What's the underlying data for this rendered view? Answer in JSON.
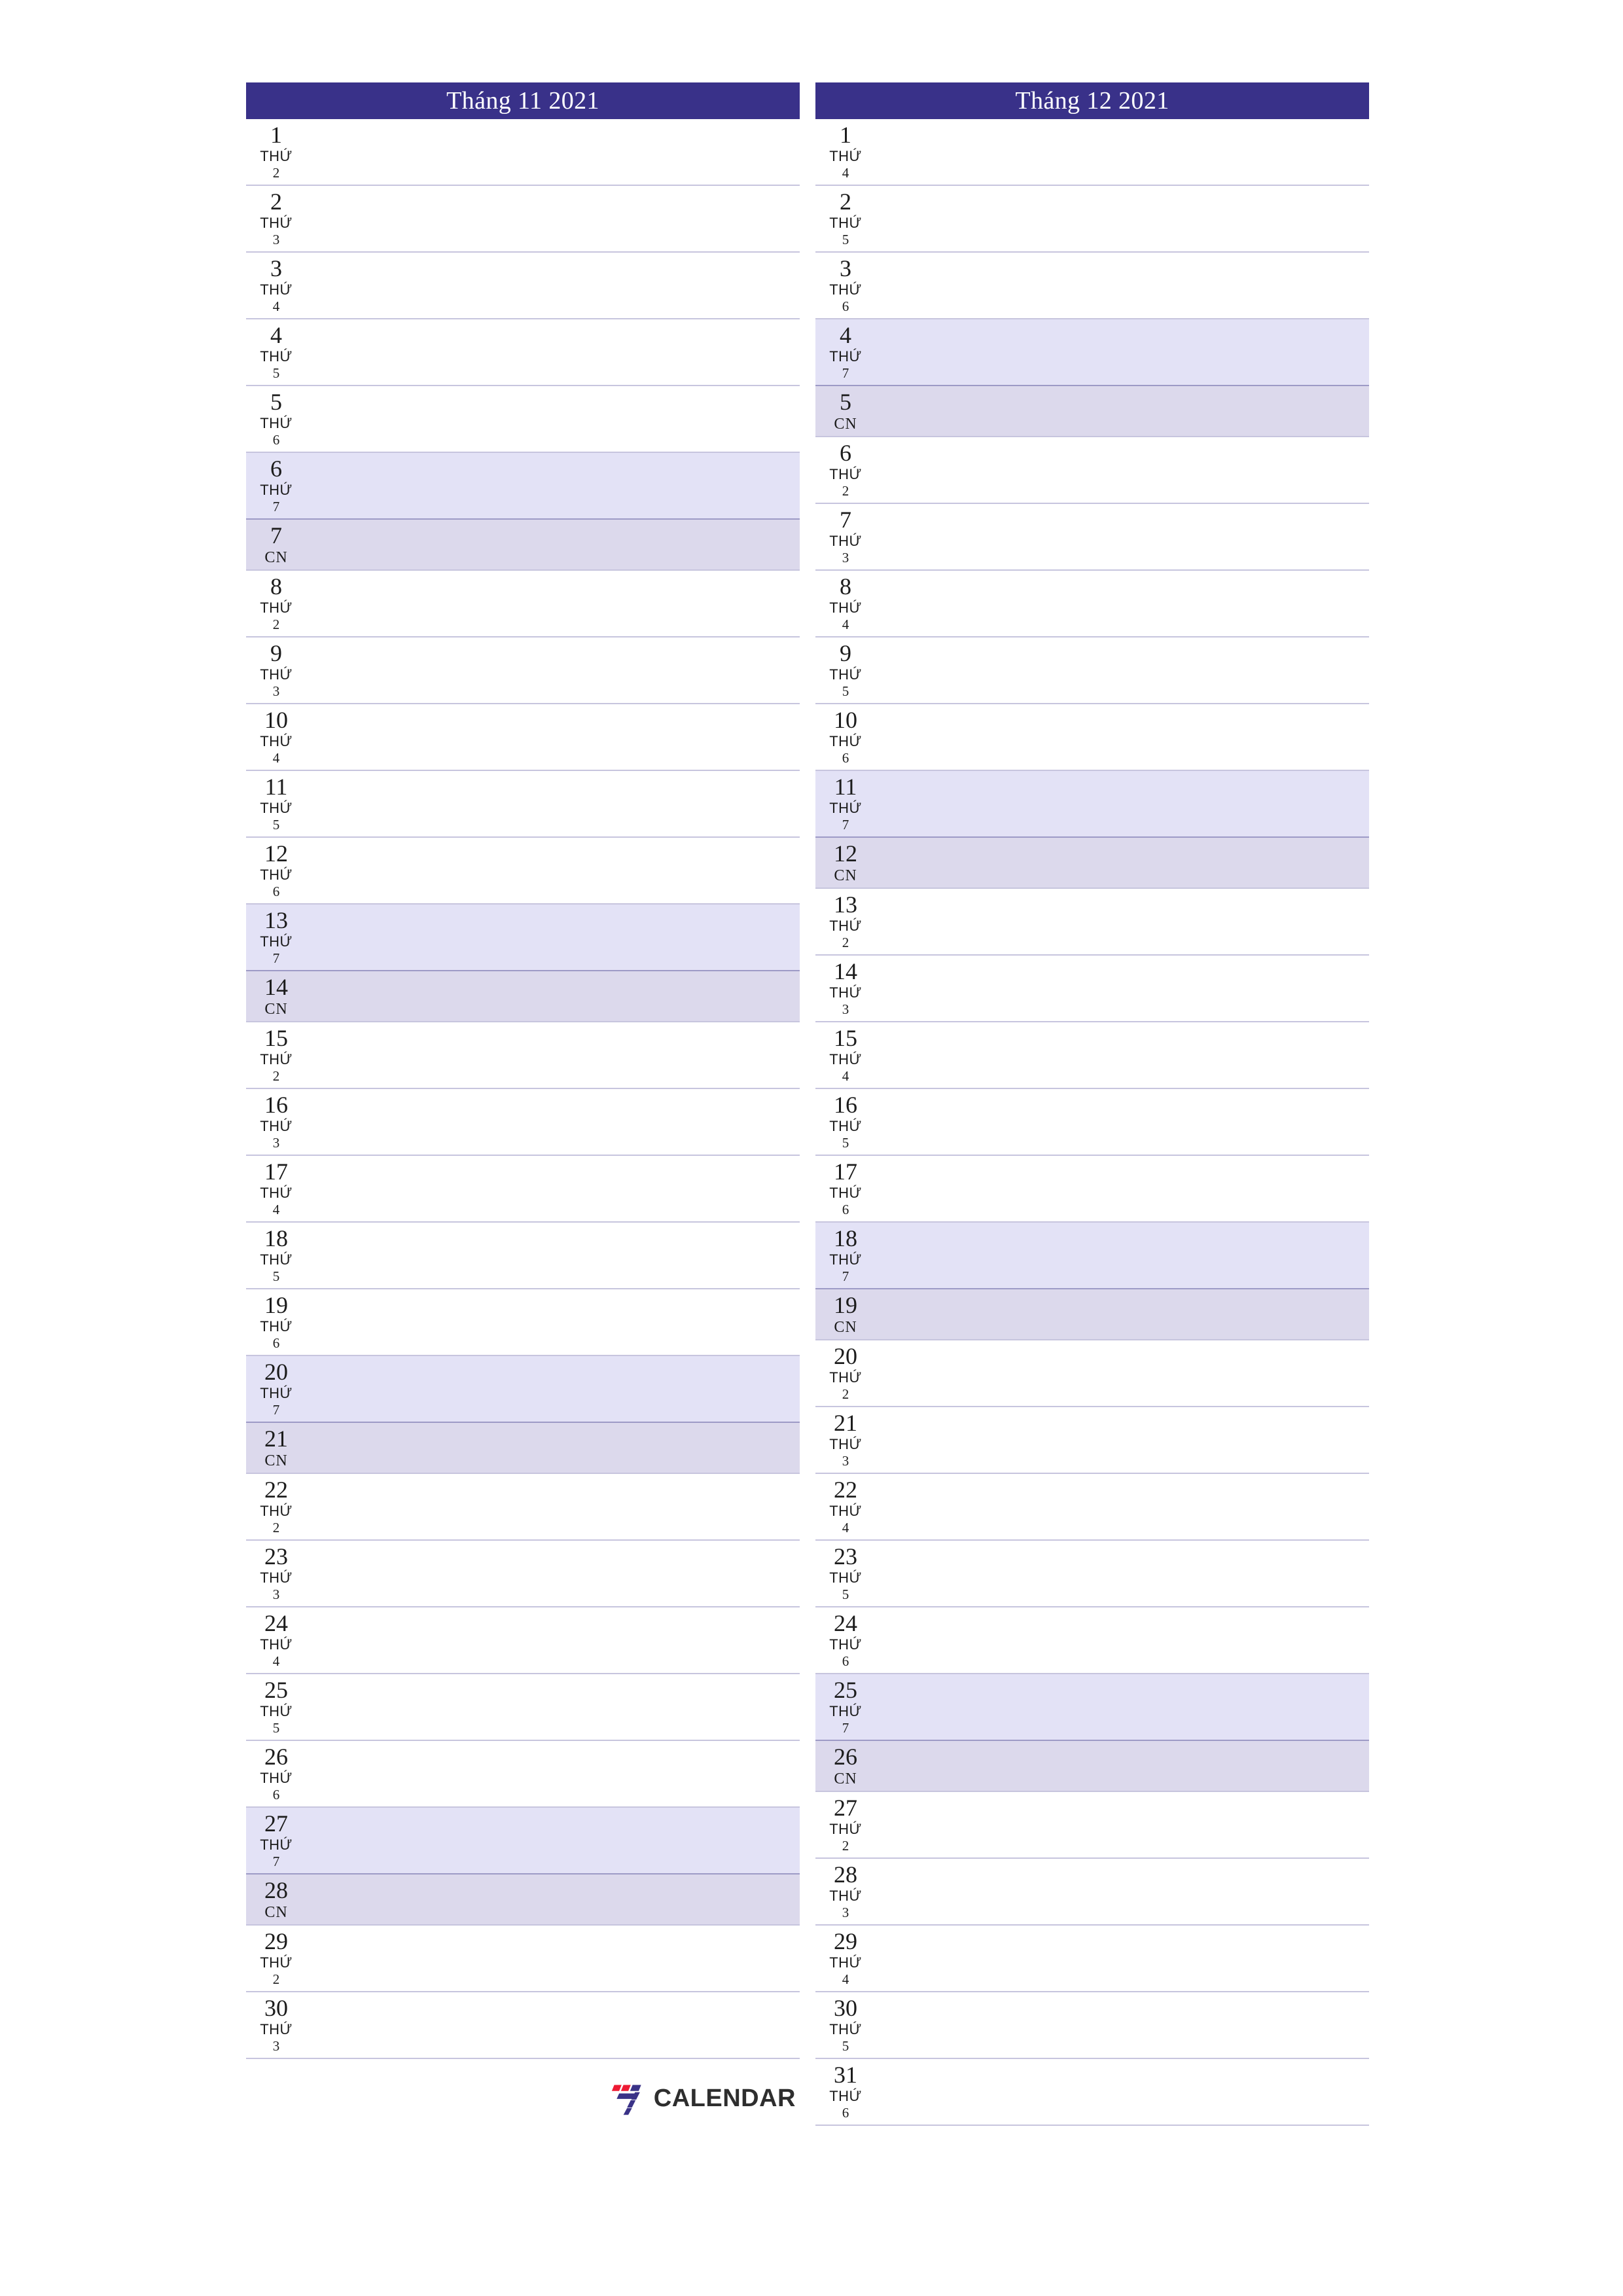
{
  "document": {
    "title": "Tháng 11 2021 - Tháng 12 2021",
    "weekday_prefix": "THỨ",
    "sunday_label": "CN"
  },
  "colors": {
    "header_background": "#393189",
    "header_text": "#ffffff",
    "saturday_background": "#e3e2f6",
    "sunday_background": "#dcd9ec",
    "row_divider": "#c7c5de",
    "weekend_divider": "#9d9ac6",
    "logo_red": "#ed1b34",
    "logo_blue": "#3a3287",
    "logo_text": "#2e2e2e"
  },
  "footer": {
    "logo_text": "CALENDAR",
    "logo_mark_name": "seven-logo-mark"
  },
  "months": [
    {
      "title": "Tháng 11 2021",
      "days": [
        {
          "num": "1",
          "prefix": "THỨ",
          "dow": "2",
          "kind": "weekday"
        },
        {
          "num": "2",
          "prefix": "THỨ",
          "dow": "3",
          "kind": "weekday"
        },
        {
          "num": "3",
          "prefix": "THỨ",
          "dow": "4",
          "kind": "weekday"
        },
        {
          "num": "4",
          "prefix": "THỨ",
          "dow": "5",
          "kind": "weekday"
        },
        {
          "num": "5",
          "prefix": "THỨ",
          "dow": "6",
          "kind": "weekday"
        },
        {
          "num": "6",
          "prefix": "THỨ",
          "dow": "7",
          "kind": "saturday"
        },
        {
          "num": "7",
          "prefix": "",
          "dow": "CN",
          "kind": "sunday"
        },
        {
          "num": "8",
          "prefix": "THỨ",
          "dow": "2",
          "kind": "weekday"
        },
        {
          "num": "9",
          "prefix": "THỨ",
          "dow": "3",
          "kind": "weekday"
        },
        {
          "num": "10",
          "prefix": "THỨ",
          "dow": "4",
          "kind": "weekday"
        },
        {
          "num": "11",
          "prefix": "THỨ",
          "dow": "5",
          "kind": "weekday"
        },
        {
          "num": "12",
          "prefix": "THỨ",
          "dow": "6",
          "kind": "weekday"
        },
        {
          "num": "13",
          "prefix": "THỨ",
          "dow": "7",
          "kind": "saturday"
        },
        {
          "num": "14",
          "prefix": "",
          "dow": "CN",
          "kind": "sunday"
        },
        {
          "num": "15",
          "prefix": "THỨ",
          "dow": "2",
          "kind": "weekday"
        },
        {
          "num": "16",
          "prefix": "THỨ",
          "dow": "3",
          "kind": "weekday"
        },
        {
          "num": "17",
          "prefix": "THỨ",
          "dow": "4",
          "kind": "weekday"
        },
        {
          "num": "18",
          "prefix": "THỨ",
          "dow": "5",
          "kind": "weekday"
        },
        {
          "num": "19",
          "prefix": "THỨ",
          "dow": "6",
          "kind": "weekday"
        },
        {
          "num": "20",
          "prefix": "THỨ",
          "dow": "7",
          "kind": "saturday"
        },
        {
          "num": "21",
          "prefix": "",
          "dow": "CN",
          "kind": "sunday"
        },
        {
          "num": "22",
          "prefix": "THỨ",
          "dow": "2",
          "kind": "weekday"
        },
        {
          "num": "23",
          "prefix": "THỨ",
          "dow": "3",
          "kind": "weekday"
        },
        {
          "num": "24",
          "prefix": "THỨ",
          "dow": "4",
          "kind": "weekday"
        },
        {
          "num": "25",
          "prefix": "THỨ",
          "dow": "5",
          "kind": "weekday"
        },
        {
          "num": "26",
          "prefix": "THỨ",
          "dow": "6",
          "kind": "weekday"
        },
        {
          "num": "27",
          "prefix": "THỨ",
          "dow": "7",
          "kind": "saturday"
        },
        {
          "num": "28",
          "prefix": "",
          "dow": "CN",
          "kind": "sunday"
        },
        {
          "num": "29",
          "prefix": "THỨ",
          "dow": "2",
          "kind": "weekday"
        },
        {
          "num": "30",
          "prefix": "THỨ",
          "dow": "3",
          "kind": "weekday"
        }
      ],
      "has_logo": true
    },
    {
      "title": "Tháng 12 2021",
      "days": [
        {
          "num": "1",
          "prefix": "THỨ",
          "dow": "4",
          "kind": "weekday"
        },
        {
          "num": "2",
          "prefix": "THỨ",
          "dow": "5",
          "kind": "weekday"
        },
        {
          "num": "3",
          "prefix": "THỨ",
          "dow": "6",
          "kind": "weekday"
        },
        {
          "num": "4",
          "prefix": "THỨ",
          "dow": "7",
          "kind": "saturday"
        },
        {
          "num": "5",
          "prefix": "",
          "dow": "CN",
          "kind": "sunday"
        },
        {
          "num": "6",
          "prefix": "THỨ",
          "dow": "2",
          "kind": "weekday"
        },
        {
          "num": "7",
          "prefix": "THỨ",
          "dow": "3",
          "kind": "weekday"
        },
        {
          "num": "8",
          "prefix": "THỨ",
          "dow": "4",
          "kind": "weekday"
        },
        {
          "num": "9",
          "prefix": "THỨ",
          "dow": "5",
          "kind": "weekday"
        },
        {
          "num": "10",
          "prefix": "THỨ",
          "dow": "6",
          "kind": "weekday"
        },
        {
          "num": "11",
          "prefix": "THỨ",
          "dow": "7",
          "kind": "saturday"
        },
        {
          "num": "12",
          "prefix": "",
          "dow": "CN",
          "kind": "sunday"
        },
        {
          "num": "13",
          "prefix": "THỨ",
          "dow": "2",
          "kind": "weekday"
        },
        {
          "num": "14",
          "prefix": "THỨ",
          "dow": "3",
          "kind": "weekday"
        },
        {
          "num": "15",
          "prefix": "THỨ",
          "dow": "4",
          "kind": "weekday"
        },
        {
          "num": "16",
          "prefix": "THỨ",
          "dow": "5",
          "kind": "weekday"
        },
        {
          "num": "17",
          "prefix": "THỨ",
          "dow": "6",
          "kind": "weekday"
        },
        {
          "num": "18",
          "prefix": "THỨ",
          "dow": "7",
          "kind": "saturday"
        },
        {
          "num": "19",
          "prefix": "",
          "dow": "CN",
          "kind": "sunday"
        },
        {
          "num": "20",
          "prefix": "THỨ",
          "dow": "2",
          "kind": "weekday"
        },
        {
          "num": "21",
          "prefix": "THỨ",
          "dow": "3",
          "kind": "weekday"
        },
        {
          "num": "22",
          "prefix": "THỨ",
          "dow": "4",
          "kind": "weekday"
        },
        {
          "num": "23",
          "prefix": "THỨ",
          "dow": "5",
          "kind": "weekday"
        },
        {
          "num": "24",
          "prefix": "THỨ",
          "dow": "6",
          "kind": "weekday"
        },
        {
          "num": "25",
          "prefix": "THỨ",
          "dow": "7",
          "kind": "saturday"
        },
        {
          "num": "26",
          "prefix": "",
          "dow": "CN",
          "kind": "sunday"
        },
        {
          "num": "27",
          "prefix": "THỨ",
          "dow": "2",
          "kind": "weekday"
        },
        {
          "num": "28",
          "prefix": "THỨ",
          "dow": "3",
          "kind": "weekday"
        },
        {
          "num": "29",
          "prefix": "THỨ",
          "dow": "4",
          "kind": "weekday"
        },
        {
          "num": "30",
          "prefix": "THỨ",
          "dow": "5",
          "kind": "weekday"
        },
        {
          "num": "31",
          "prefix": "THỨ",
          "dow": "6",
          "kind": "weekday"
        }
      ],
      "has_logo": false
    }
  ]
}
